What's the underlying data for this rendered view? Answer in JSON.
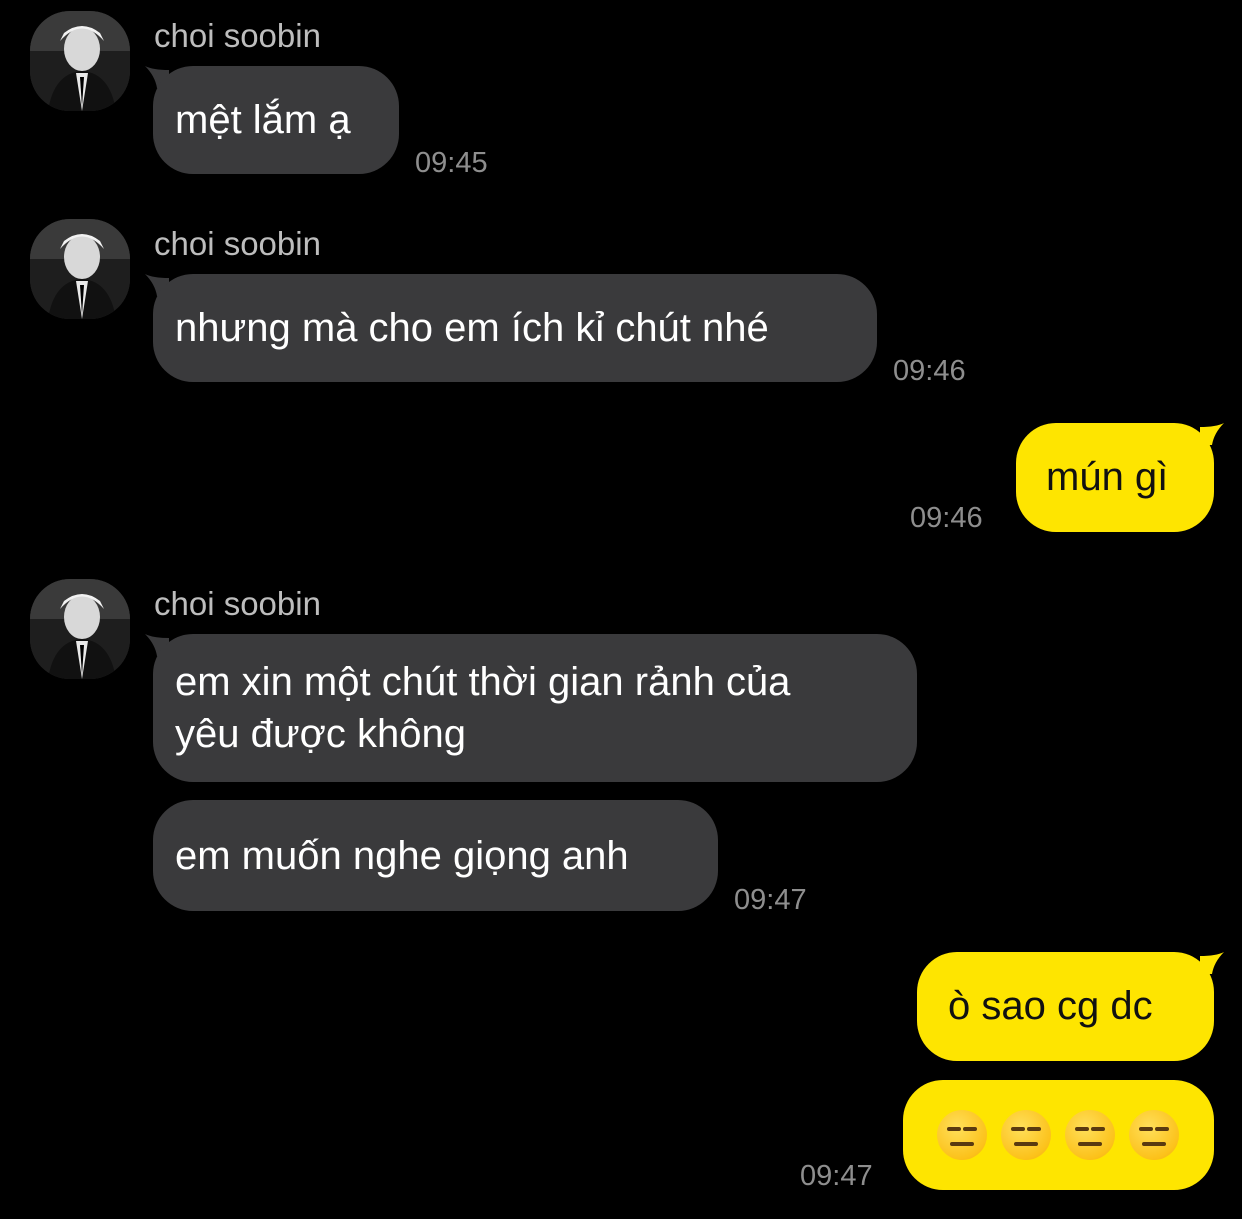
{
  "contact": {
    "name": "choi soobin",
    "avatar_icon": "profile-photo"
  },
  "colors": {
    "background": "#000000",
    "incoming_bubble": "#3a3a3c",
    "outgoing_bubble": "#fee500",
    "timestamp": "#8e8e8e"
  },
  "messages": [
    {
      "direction": "incoming",
      "sender": "choi soobin",
      "lines": [
        "mệt lắm ạ"
      ],
      "time": "09:45"
    },
    {
      "direction": "incoming",
      "sender": "choi soobin",
      "lines": [
        "nhưng mà cho em ích kỉ chút nhé"
      ],
      "time": "09:46"
    },
    {
      "direction": "outgoing",
      "lines": [
        "mún gì"
      ],
      "time": "09:46"
    },
    {
      "direction": "incoming",
      "sender": "choi soobin",
      "lines": [
        "em xin một chút thời gian rảnh của",
        "yêu được không"
      ]
    },
    {
      "direction": "incoming",
      "lines": [
        "em muốn nghe giọng anh"
      ],
      "time": "09:47"
    },
    {
      "direction": "outgoing",
      "lines": [
        "ò sao cg dc"
      ]
    },
    {
      "direction": "outgoing",
      "emoji": [
        "expressionless-face",
        "expressionless-face",
        "expressionless-face",
        "expressionless-face"
      ],
      "time": "09:47"
    }
  ]
}
